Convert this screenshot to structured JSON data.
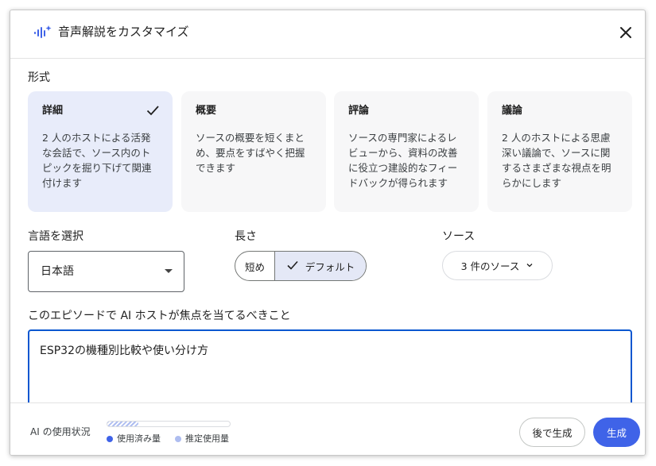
{
  "dialog": {
    "title": "音声解説をカスタマイズ",
    "close_icon": "close-icon",
    "title_icon": "audio-wave-icon"
  },
  "format": {
    "label": "形式",
    "selected_index": 0,
    "cards": [
      {
        "title": "詳細",
        "desc": "2 人のホストによる活発な会話で、ソース内のトピックを掘り下げて関連付けます"
      },
      {
        "title": "概要",
        "desc": "ソースの概要を短くまとめ、要点をすばやく把握できます"
      },
      {
        "title": "評論",
        "desc": "ソースの専門家によるレビューから、資料の改善に役立つ建設的なフィードバックが得られます"
      },
      {
        "title": "議論",
        "desc": "2 人のホストによる思慮深い議論で、ソースに関するさまざまな視点を明らかにします"
      }
    ]
  },
  "language": {
    "label": "言語を選択",
    "value": "日本語"
  },
  "length": {
    "label": "長さ",
    "options": [
      "短め",
      "デフォルト"
    ],
    "selected": "デフォルト"
  },
  "sources": {
    "label": "ソース",
    "button_label": "3 件のソース"
  },
  "focus": {
    "label": "このエピソードで AI ホストが焦点を当てるべきこと",
    "value": "ESP32の機種別比較や使い分け方"
  },
  "footer": {
    "usage_label": "AI の使用状況",
    "usage_fraction": 0.25,
    "legend_used": "使用済み量",
    "legend_estimated": "推定使用量",
    "later_button": "後で生成",
    "generate_button": "生成"
  },
  "colors": {
    "accent": "#3f63e8",
    "selected_card": "#e8ecfa",
    "legend_used": "#3f63e8",
    "legend_estimated": "#aebdf0"
  }
}
